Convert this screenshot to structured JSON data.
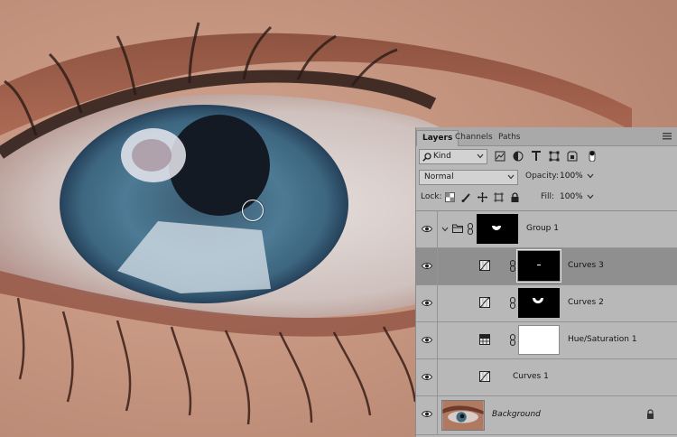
{
  "panel": {
    "tabs": [
      {
        "label": "Layers",
        "active": true
      },
      {
        "label": "Channels",
        "active": false
      },
      {
        "label": "Paths",
        "active": false
      }
    ],
    "filter_kind": "Kind",
    "blend_mode": "Normal",
    "opacity_label": "Opacity:",
    "opacity_value": "100%",
    "lock_label": "Lock:",
    "fill_label": "Fill:",
    "fill_value": "100%"
  },
  "layers": [
    {
      "name": "Group 1",
      "type": "group",
      "visible": true,
      "expanded": true
    },
    {
      "name": "Curves 3",
      "type": "curves",
      "visible": true,
      "selected": true
    },
    {
      "name": "Curves 2",
      "type": "curves",
      "visible": true
    },
    {
      "name": "Hue/Saturation 1",
      "type": "hue-saturation",
      "visible": true
    },
    {
      "name": "Curves 1",
      "type": "curves",
      "visible": true
    },
    {
      "name": "Background",
      "type": "pixel",
      "visible": true,
      "locked": true
    }
  ],
  "colors": {
    "panel_bg": "#b8b8b8",
    "selected_row": "#8f8f8f",
    "iris": "#4a7690"
  }
}
